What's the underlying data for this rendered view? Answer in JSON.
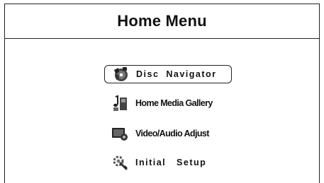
{
  "header": {
    "title": "Home Menu"
  },
  "menu": {
    "selected_index": 0,
    "items": [
      {
        "label": "Disc  Navigator",
        "icon": "disc-navigator-icon"
      },
      {
        "label": "Home Media Gallery",
        "icon": "media-gallery-icon"
      },
      {
        "label": "Video/Audio Adjust",
        "icon": "video-audio-icon"
      },
      {
        "label": "Initial   Setup",
        "icon": "setup-wrench-icon"
      }
    ]
  },
  "colors": {
    "background": "#ffffff",
    "border": "#222222",
    "text": "#111111"
  }
}
